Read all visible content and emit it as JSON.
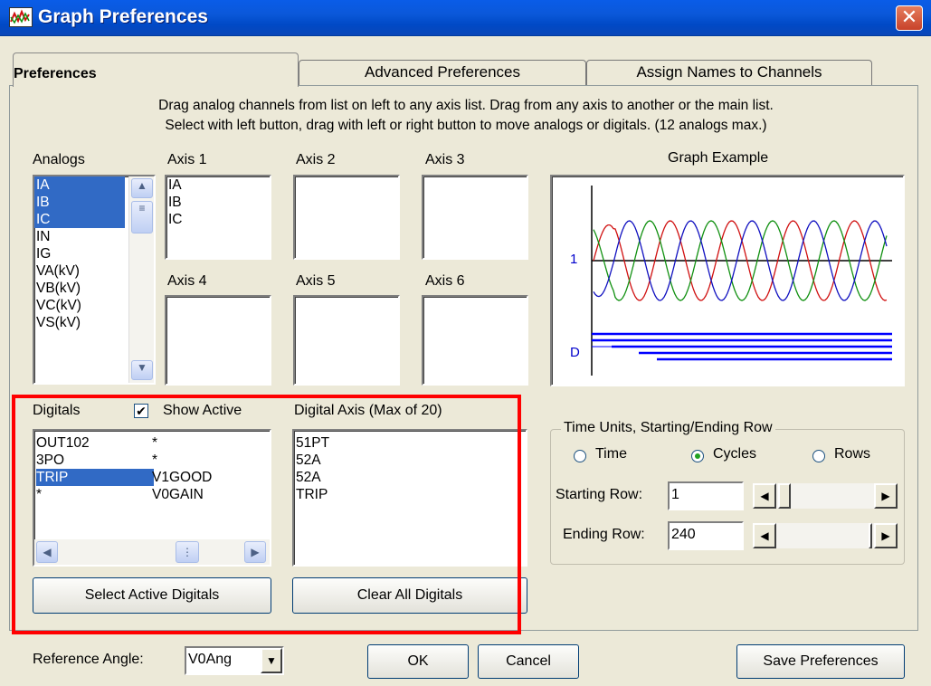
{
  "window": {
    "title": "Graph Preferences",
    "close_glyph": "✕"
  },
  "tabs": [
    {
      "label": "Preferences",
      "active": true
    },
    {
      "label": "Advanced Preferences",
      "active": false
    },
    {
      "label": "Assign Names to Channels",
      "active": false
    }
  ],
  "instructions": [
    "Drag analog channels from list on left to any axis list. Drag from any axis to another or the main list.",
    "Select with left button, drag with left or right button to move analogs or digitals. (12 analogs max.)"
  ],
  "analogs": {
    "label": "Analogs",
    "items": [
      "IA",
      "IB",
      "IC",
      "IN",
      "IG",
      "VA(kV)",
      "VB(kV)",
      "VC(kV)",
      "VS(kV)"
    ],
    "selected": [
      "IA",
      "IB",
      "IC"
    ]
  },
  "axes": [
    {
      "label": "Axis 1",
      "items": [
        "IA",
        "IB",
        "IC"
      ]
    },
    {
      "label": "Axis 2",
      "items": []
    },
    {
      "label": "Axis 3",
      "items": []
    },
    {
      "label": "Axis 4",
      "items": []
    },
    {
      "label": "Axis 5",
      "items": []
    },
    {
      "label": "Axis 6",
      "items": []
    }
  ],
  "graph_example": {
    "label": "Graph Example",
    "axis_label_1": "1",
    "axis_label_d": "D",
    "colors": {
      "red": "#d01010",
      "green": "#109010",
      "blue": "#1010c0",
      "axis": "#000000",
      "digital": "#0000ff"
    }
  },
  "digitals": {
    "label": "Digitals",
    "show_active_label": "Show Active",
    "show_active_checked": true,
    "rows": [
      {
        "col1": "OUT102",
        "col2": "*"
      },
      {
        "col1": "3PO",
        "col2": "*"
      },
      {
        "col1": "TRIP",
        "col2": "V1GOOD",
        "selected": true
      },
      {
        "col1": "*",
        "col2": "V0GAIN"
      }
    ],
    "select_active_button": "Select Active Digitals"
  },
  "digital_axis": {
    "label": "Digital Axis (Max of 20)",
    "items": [
      "51PT",
      "52A",
      "52A",
      "TRIP"
    ],
    "clear_button": "Clear All Digitals"
  },
  "time_units": {
    "group_label": "Time Units, Starting/Ending Row",
    "options": [
      {
        "label": "Time",
        "checked": false
      },
      {
        "label": "Cycles",
        "checked": true
      },
      {
        "label": "Rows",
        "checked": false
      }
    ],
    "starting_row_label": "Starting Row:",
    "starting_row_value": "1",
    "ending_row_label": "Ending Row:",
    "ending_row_value": "240"
  },
  "footer": {
    "reference_angle_label": "Reference Angle:",
    "reference_angle_value": "V0Ang",
    "ok_button": "OK",
    "cancel_button": "Cancel",
    "save_button": "Save Preferences"
  }
}
